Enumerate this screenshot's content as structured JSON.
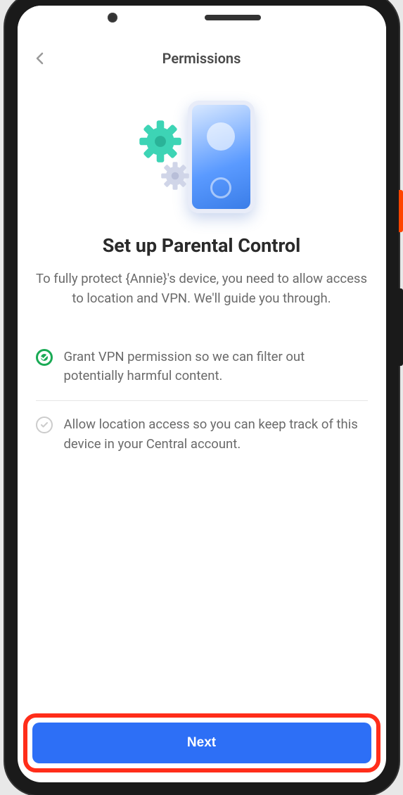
{
  "header": {
    "title": "Permissions"
  },
  "main": {
    "title": "Set up Parental Control",
    "description": "To fully protect {Annie}'s device, you need to allow access to location and VPN. We'll guide you through."
  },
  "permissions": [
    {
      "text": "Grant VPN permission so we can filter out potentially harmful content.",
      "status": "done"
    },
    {
      "text": "Allow location access so you can keep track of this device in your Central account.",
      "status": "pending"
    }
  ],
  "actions": {
    "next": "Next"
  }
}
